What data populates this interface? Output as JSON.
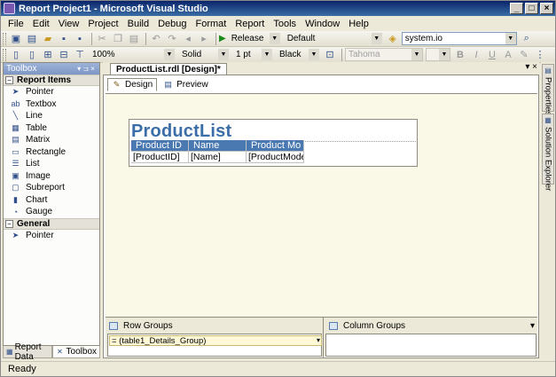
{
  "window": {
    "title": "Report Project1 - Microsoft Visual Studio",
    "min": "_",
    "max": "□",
    "close": "×"
  },
  "menu": [
    "File",
    "Edit",
    "View",
    "Project",
    "Build",
    "Debug",
    "Format",
    "Report",
    "Tools",
    "Window",
    "Help"
  ],
  "toolbar1": {
    "config": "Release",
    "platform": "Default",
    "find": "system.io"
  },
  "toolbar2": {
    "zoom": "100%",
    "border_style": "Solid",
    "border_width": "1 pt",
    "border_color": "Black",
    "font": "Tahoma",
    "bold": "B",
    "italic": "I",
    "underline": "U",
    "font_color": "A"
  },
  "toolbox": {
    "title": "Toolbox",
    "pin": "▾ ⊐ ×",
    "categories": [
      {
        "name": "Report Items",
        "items": [
          {
            "label": "Pointer",
            "icon": "pointer-icon",
            "glyph": "➤"
          },
          {
            "label": "Textbox",
            "icon": "textbox-icon",
            "glyph": "ab"
          },
          {
            "label": "Line",
            "icon": "line-icon",
            "glyph": "╲"
          },
          {
            "label": "Table",
            "icon": "table-icon",
            "glyph": "▦"
          },
          {
            "label": "Matrix",
            "icon": "matrix-icon",
            "glyph": "▤"
          },
          {
            "label": "Rectangle",
            "icon": "rectangle-icon",
            "glyph": "▭"
          },
          {
            "label": "List",
            "icon": "list-icon",
            "glyph": "☰"
          },
          {
            "label": "Image",
            "icon": "image-icon",
            "glyph": "▣"
          },
          {
            "label": "Subreport",
            "icon": "subreport-icon",
            "glyph": "▢"
          },
          {
            "label": "Chart",
            "icon": "chart-icon",
            "glyph": "▮"
          },
          {
            "label": "Gauge",
            "icon": "gauge-icon",
            "glyph": "◔"
          }
        ]
      },
      {
        "name": "General",
        "items": [
          {
            "label": "Pointer",
            "icon": "pointer-icon",
            "glyph": "➤"
          }
        ]
      }
    ]
  },
  "left_tabs": {
    "report_data": "Report Data",
    "toolbox": "Toolbox"
  },
  "document": {
    "tab": "ProductList.rdl [Design]*",
    "controls": "▾ ×",
    "design_tab": "Design",
    "preview_tab": "Preview"
  },
  "report": {
    "title": "ProductList",
    "headers": [
      "Product ID",
      "Name",
      "Product Mo"
    ],
    "row": [
      "[ProductID]",
      "[Name]",
      "[ProductModel]"
    ]
  },
  "groups": {
    "row_groups": "Row Groups",
    "column_groups": "Column Groups",
    "row_group_item": "= (table1_Details_Group)",
    "dropdown": "▾"
  },
  "side_tabs": {
    "properties": "Properties",
    "solution_explorer": "Solution Explorer"
  },
  "status": "Ready"
}
